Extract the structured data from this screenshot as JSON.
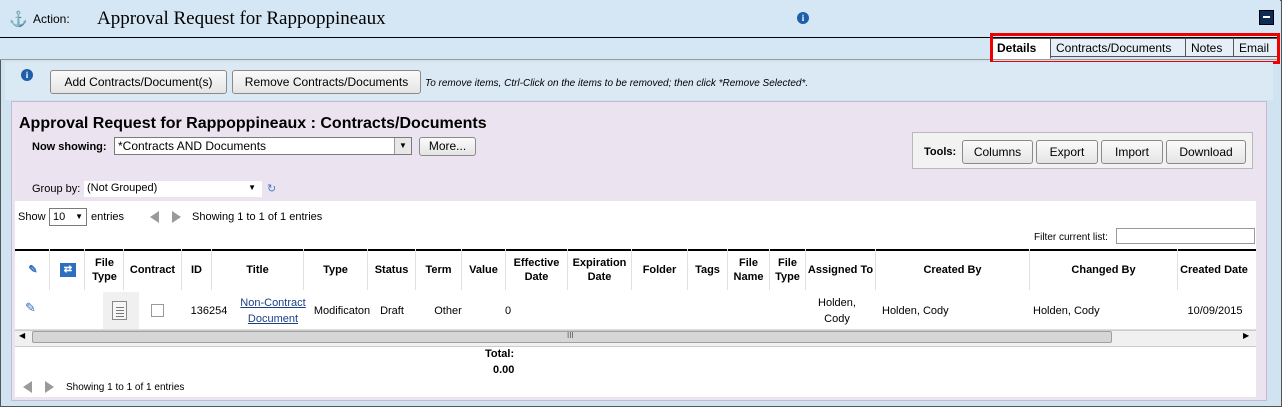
{
  "header": {
    "action_label": "Action:",
    "title": "Approval Request for Rappoppineaux"
  },
  "tabs": [
    {
      "label": "Details",
      "active": true
    },
    {
      "label": "Contracts/Documents",
      "active": false
    },
    {
      "label": "Notes",
      "active": false
    },
    {
      "label": "Email",
      "active": false
    }
  ],
  "toolbar": {
    "add_label": "Add Contracts/Document(s)",
    "remove_label": "Remove Contracts/Documents",
    "hint": "To remove items, Ctrl-Click on the items to be removed; then click *Remove Selected*."
  },
  "panel": {
    "title": "Approval Request for Rappoppineaux : Contracts/Documents",
    "now_showing_label": "Now showing:",
    "now_showing_value": "*Contracts AND Documents",
    "more_label": "More...",
    "tools_label": "Tools:",
    "tools": [
      "Columns",
      "Export",
      "Import",
      "Download"
    ],
    "group_by_label": "Group by:",
    "group_by_value": "(Not Grouped)"
  },
  "table": {
    "show_label": "Show",
    "page_size": "10",
    "entries_label": "entries",
    "showing_text": "Showing 1 to 1 of 1 entries",
    "filter_label": "Filter current list:",
    "columns": [
      "File Type",
      "Contract",
      "ID",
      "Title",
      "Type",
      "Status",
      "Term",
      "Value",
      "Effective Date",
      "Expiration Date",
      "Folder",
      "Tags",
      "File Name",
      "File Type",
      "Assigned To",
      "Created By",
      "Changed By",
      "Created Date"
    ],
    "row": {
      "id": "136254",
      "title": "Non-Contract Document",
      "type": "Modificaton",
      "status": "Draft",
      "term": "Other",
      "value": "0",
      "assigned_to": "Holden, Cody",
      "created_by": "Holden, Cody",
      "changed_by": "Holden, Cody",
      "created_date": "10/09/2015"
    },
    "scrollbar_grip": "III",
    "total_label": "Total:",
    "total_value": "0.00",
    "footer_showing": "Showing 1 to 1 of 1 entries"
  }
}
